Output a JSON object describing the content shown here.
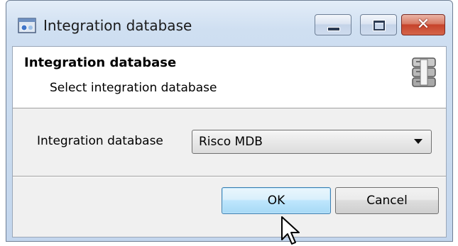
{
  "window": {
    "title": "Integration database"
  },
  "header": {
    "title": "Integration database",
    "subtitle": "Select integration database",
    "icon": "database-icon"
  },
  "form": {
    "label": "Integration database",
    "select_value": "Risco MDB"
  },
  "buttons": {
    "ok": "OK",
    "cancel": "Cancel"
  },
  "titlebar_buttons": [
    "minimize-icon",
    "maximize-icon",
    "close-icon"
  ]
}
